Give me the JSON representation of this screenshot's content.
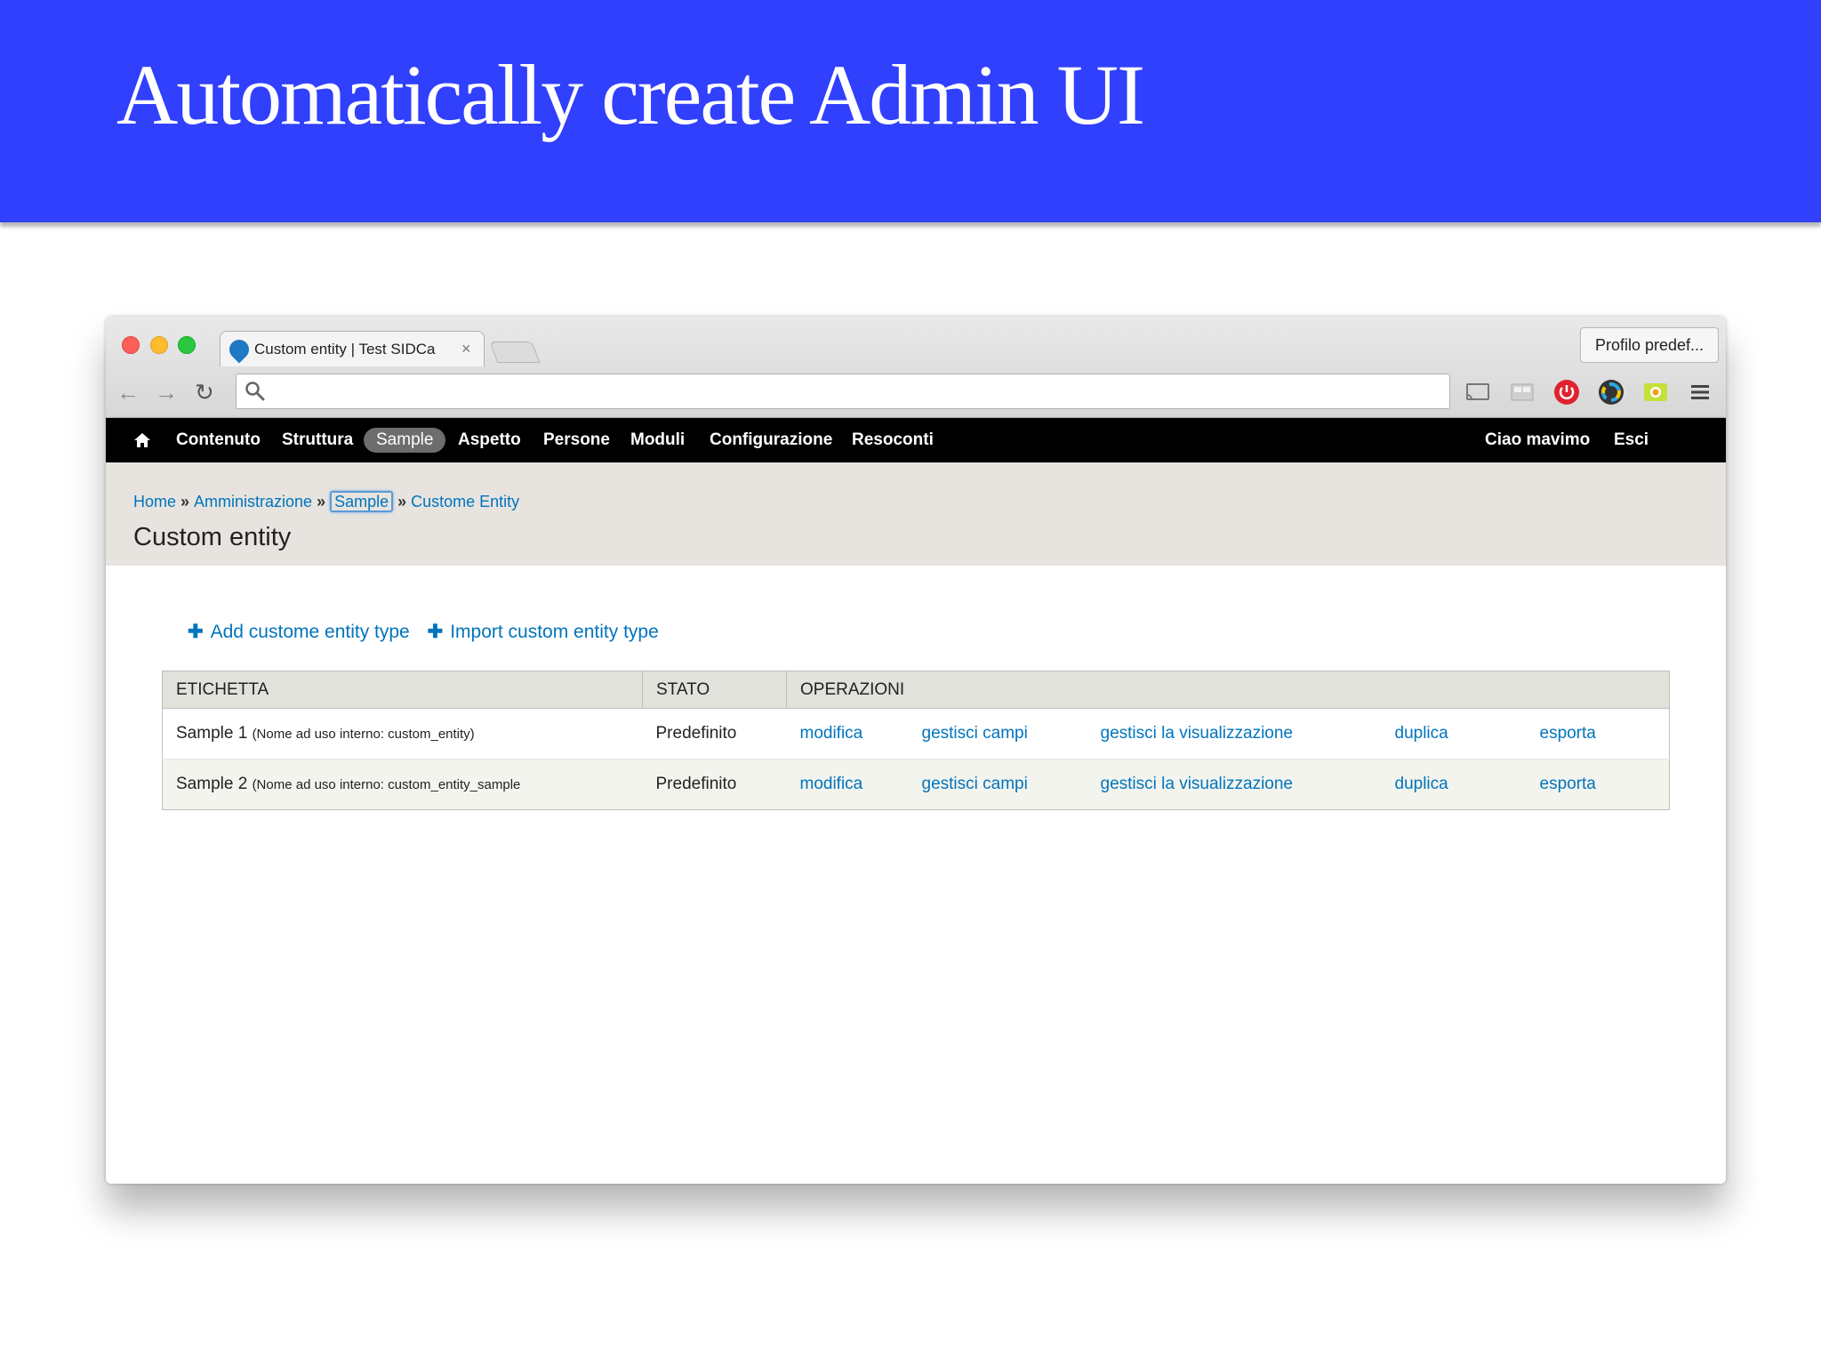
{
  "slide": {
    "title": "Automatically create Admin UI"
  },
  "browser": {
    "tab_title": "Custom entity | Test SIDCa",
    "tab_close": "×",
    "profile_button": "Profilo predef...",
    "address_value": "",
    "nav": {
      "back": "←",
      "forward": "→",
      "reload": "↻"
    }
  },
  "toolbar": {
    "items": [
      "Contenuto",
      "Struttura",
      "Sample",
      "Aspetto",
      "Persone",
      "Moduli",
      "Configurazione",
      "Resoconti"
    ],
    "active_item": "Sample",
    "greeting": "Ciao mavimo",
    "logout": "Esci"
  },
  "breadcrumb": [
    "Home",
    "Amministrazione",
    "Sample",
    "Custome Entity"
  ],
  "breadcrumb_sep": "»",
  "page_title": "Custom entity",
  "actions": {
    "add": "Add custome entity type",
    "import": "Import custom entity type",
    "plus": "✚"
  },
  "table": {
    "headers": {
      "label": "ETICHETTA",
      "status": "STATO",
      "operations": "OPERAZIONI"
    },
    "rows": [
      {
        "label": "Sample 1",
        "machine": "(Nome ad uso interno: custom_entity)",
        "status": "Predefinito",
        "ops": [
          "modifica",
          "gestisci campi",
          "gestisci la visualizzazione",
          "duplica",
          "esporta"
        ]
      },
      {
        "label": "Sample 2",
        "machine": "(Nome ad uso interno: custom_entity_sample",
        "status": "Predefinito",
        "ops": [
          "modifica",
          "gestisci campi",
          "gestisci la visualizzazione",
          "duplica",
          "esporta"
        ]
      }
    ]
  },
  "colors": {
    "slide_header": "#3140fd",
    "link": "#0074bd",
    "toolbar_bg": "#000000",
    "page_band": "#e7e4df"
  }
}
